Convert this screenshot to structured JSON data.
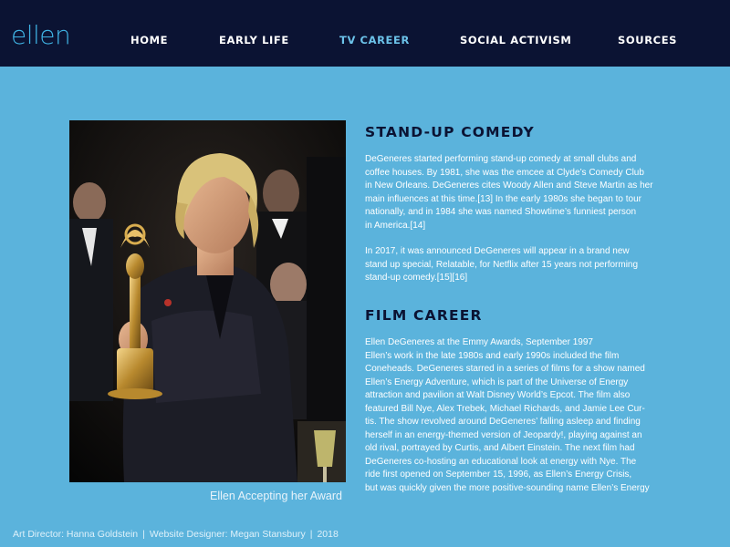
{
  "header": {
    "logo": "ellen",
    "nav": [
      {
        "label": "HOME"
      },
      {
        "label": "EARLY LIFE"
      },
      {
        "label": "TV CAREER"
      },
      {
        "label": "SOCIAL ACTIVISM"
      },
      {
        "label": "SOURCES"
      }
    ],
    "active_label": "TV CAREER"
  },
  "photo": {
    "caption": "Ellen Accepting her Award"
  },
  "sections": {
    "standup": {
      "heading": "STAND-UP COMEDY",
      "p1_lines": [
        "DeGeneres started performing stand-up comedy at small clubs and",
        "coffee houses. By 1981, she was the emcee at Clyde’s Comedy Club",
        "in New Orleans. DeGeneres cites Woody Allen and Steve Martin as her",
        "main influences at this time.[13] In the early 1980s she began to tour",
        "nationally, and in 1984 she was named Showtime’s funniest person",
        "in America.[14]"
      ],
      "p2_lines": [
        "In 2017, it was announced DeGeneres will appear in a brand new",
        "stand up special, Relatable, for Netflix after 15 years not performing",
        "stand-up comedy.[15][16]"
      ]
    },
    "film": {
      "heading": "FILM CAREER",
      "lines": [
        "Ellen DeGeneres at the Emmy Awards, September 1997",
        "Ellen’s work in the late 1980s and early 1990s included the film",
        "Coneheads. DeGeneres starred in a series of films for a show named",
        "Ellen’s Energy Adventure, which is part of the Universe of Energy",
        "attraction and pavilion at Walt Disney World’s Epcot. The film also",
        "featured Bill Nye, Alex Trebek, Michael Richards, and Jamie Lee Cur-",
        "tis. The show revolved around DeGeneres’ falling asleep and finding",
        "herself in an energy-themed version of Jeopardy!, playing against an",
        "old rival, portrayed by Curtis, and Albert Einstein. The next film had",
        "DeGeneres co-hosting an educational look at energy with Nye. The",
        "ride first opened on September 15, 1996, as Ellen’s Energy Crisis,",
        "but was quickly given the more positive-sounding name Ellen’s Energy"
      ]
    }
  },
  "footer": {
    "art_director": "Art Director: Hanna Goldstein",
    "designer": "Website Designer: Megan Stansbury",
    "year": "2018",
    "separator": "|"
  },
  "colors": {
    "background": "#5bb3dc",
    "navbar": "#0b1333",
    "accent": "#6cc3ea",
    "heading": "#0b1333"
  }
}
